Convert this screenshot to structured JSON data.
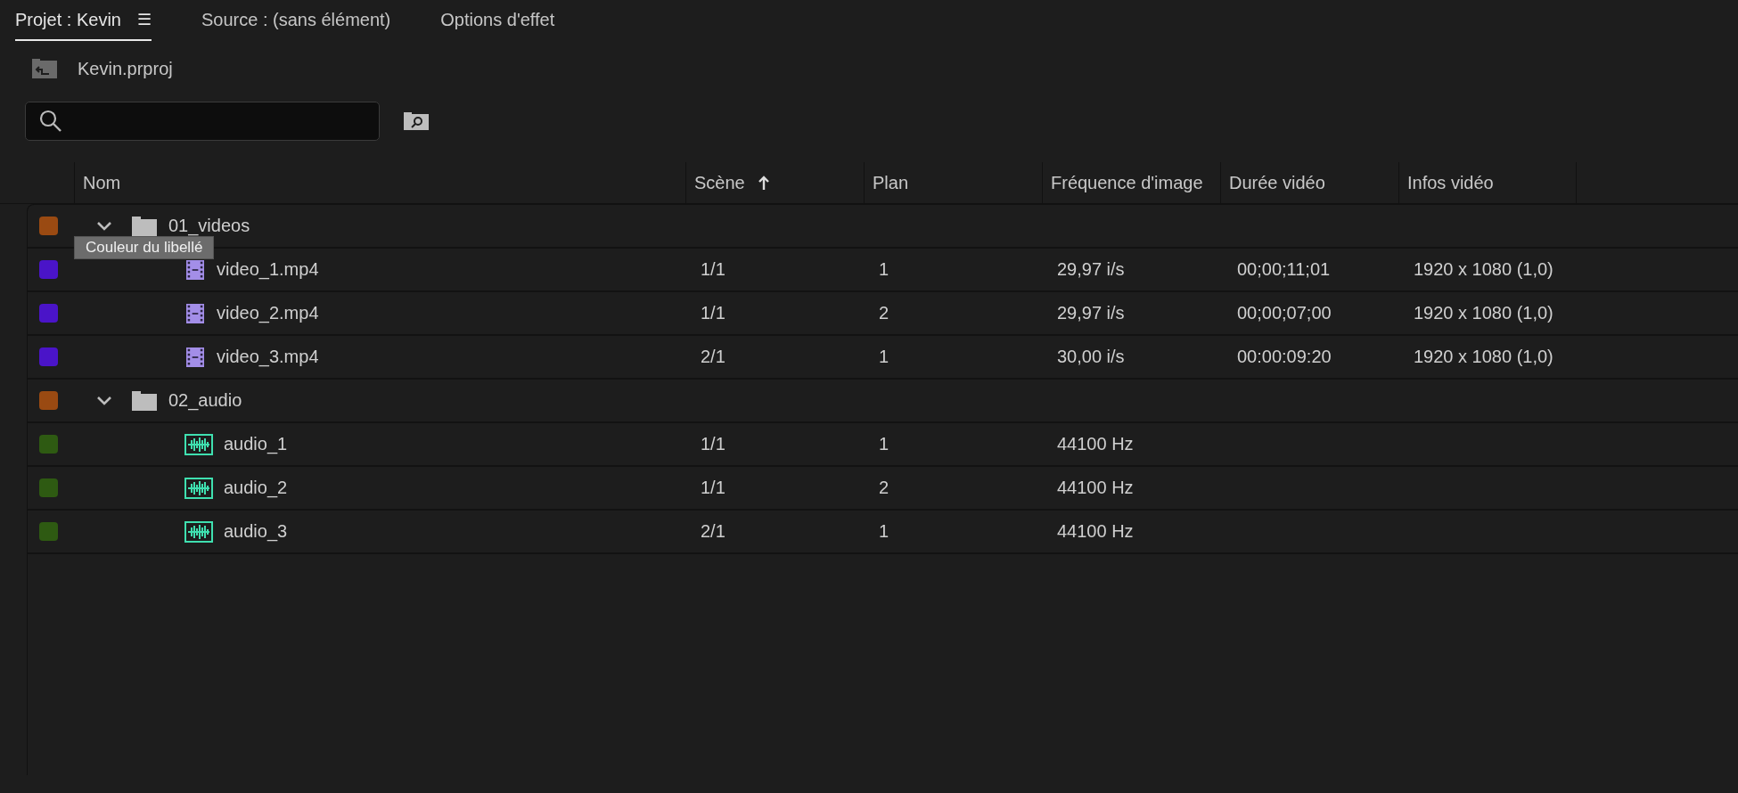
{
  "tabs": [
    {
      "label": "Projet : Kevin",
      "selected": true,
      "menu": "☰"
    },
    {
      "label": "Source : (sans élément)",
      "selected": false
    },
    {
      "label": "Options d'effet",
      "selected": false
    }
  ],
  "project": {
    "name": "Kevin.prproj"
  },
  "table": {
    "columns": [
      {
        "label": "Nom",
        "sorted": false
      },
      {
        "label": "Scène",
        "sorted": true
      },
      {
        "label": "Plan",
        "sorted": false
      },
      {
        "label": "Fréquence d'image",
        "sorted": false
      },
      {
        "label": "Durée vidéo",
        "sorted": false
      },
      {
        "label": "Infos vidéo",
        "sorted": false
      }
    ],
    "items": [
      {
        "kind": "folder",
        "name": "01_videos",
        "color": "#9a4a12",
        "expanded": true,
        "children": [
          {
            "kind": "video",
            "name": "video_1.mp4",
            "color": "#4a14c8",
            "cells": [
              "1/1",
              "1",
              "29,97 i/s",
              "00;00;11;01",
              "1920 x 1080 (1,0)"
            ]
          },
          {
            "kind": "video",
            "name": "video_2.mp4",
            "color": "#4a14c8",
            "cells": [
              "1/1",
              "2",
              "29,97 i/s",
              "00;00;07;00",
              "1920 x 1080 (1,0)"
            ]
          },
          {
            "kind": "video",
            "name": "video_3.mp4",
            "color": "#4a14c8",
            "cells": [
              "2/1",
              "1",
              "30,00 i/s",
              "00:00:09:20",
              "1920 x 1080 (1,0)"
            ]
          }
        ]
      },
      {
        "kind": "folder",
        "name": "02_audio",
        "color": "#9a4a12",
        "expanded": true,
        "children": [
          {
            "kind": "audio",
            "name": "audio_1",
            "color": "#2e5a12",
            "cells": [
              "1/1",
              "1",
              "44100  Hz"
            ]
          },
          {
            "kind": "audio",
            "name": "audio_2",
            "color": "#2e5a12",
            "cells": [
              "1/1",
              "2",
              "44100  Hz"
            ]
          },
          {
            "kind": "audio",
            "name": "audio_3",
            "color": "#2e5a12",
            "cells": [
              "2/1",
              "1",
              "44100  Hz"
            ]
          }
        ]
      }
    ]
  },
  "tooltip": {
    "text": "Couleur du libellé"
  }
}
